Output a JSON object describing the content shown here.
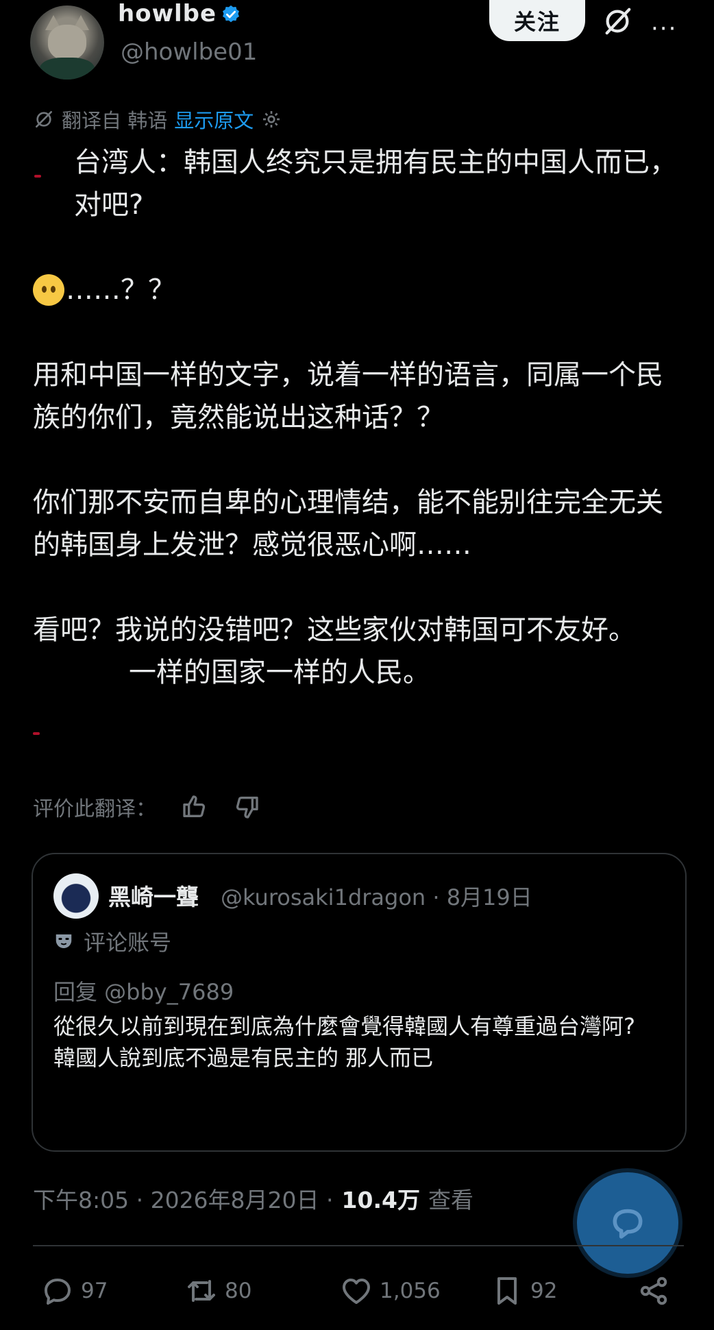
{
  "author": {
    "display_name": "howlbe",
    "handle": "@howlbe01"
  },
  "header": {
    "follow_label": "关注",
    "more_label": "···"
  },
  "translation": {
    "translated_from": "翻译自 韩语",
    "show_original": "显示原文"
  },
  "post": {
    "lines": [
      "台湾人：韩国人终究只是拥有民主的中国人而已，对吧?",
      "……？？",
      "用和中国一样的文字，说着一样的语言，同属一个民族的你们，竟然能说出这种话？？",
      "你们那不安而自卑的心理情结，能不能别往完全无关的韩国身上发泄？感觉很恶心啊……",
      "看吧？我说的没错吧？这些家伙对韩国可不友好。",
      "一样的国家一样的人民。"
    ]
  },
  "rate_translation": "评价此翻译：",
  "quote": {
    "name": "黑崎一聾",
    "meta": "@kurosaki1dragon · 8月19日",
    "account_label": "评论账号",
    "reply_to": "回复 @bby_7689",
    "lines": [
      "從很久以前到現在到底為什麼會覺得韓國人有尊重過台灣阿?",
      "韓國人說到底不過是有民主的 那人而已"
    ]
  },
  "timestamp": {
    "time": "下午8:05 · 2026年8月20日 ·",
    "views": "10.4万",
    "views_label": "查看"
  },
  "actions": {
    "replies": "97",
    "reposts": "80",
    "likes": "1,056",
    "bookmarks": "92"
  },
  "colors": {
    "background": "#000000",
    "text": "#e7e9ea",
    "secondary": "#71767b",
    "accent": "#1d9bf0"
  }
}
